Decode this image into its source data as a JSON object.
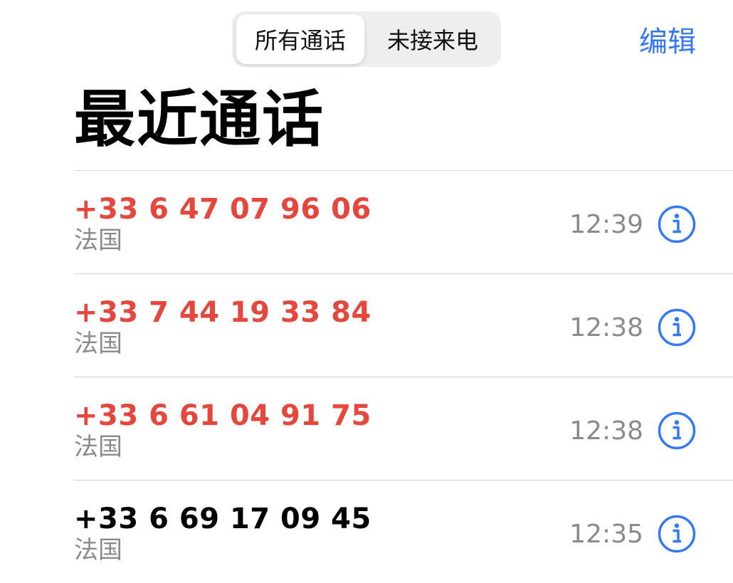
{
  "header": {
    "segments": [
      {
        "label": "所有通话",
        "selected": true
      },
      {
        "label": "未接来电",
        "selected": false
      }
    ],
    "edit_label": "编辑"
  },
  "page_title": "最近通话",
  "colors": {
    "accent": "#3478f6",
    "missed": "#e5473d",
    "secondary_text": "#8a8a8e"
  },
  "calls": [
    {
      "number": "+33 6 47 07 96 06",
      "location": "法国",
      "time": "12:39",
      "missed": true
    },
    {
      "number": "+33 7 44 19 33 84",
      "location": "法国",
      "time": "12:38",
      "missed": true
    },
    {
      "number": "+33 6 61 04 91 75",
      "location": "法国",
      "time": "12:38",
      "missed": true
    },
    {
      "number": "+33 6 69 17 09 45",
      "location": "法国",
      "time": "12:35",
      "missed": false
    }
  ]
}
